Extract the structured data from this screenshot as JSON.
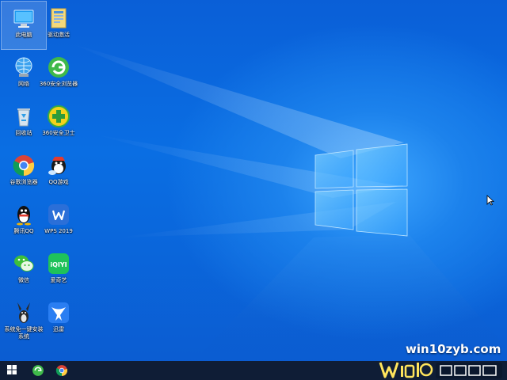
{
  "desktop": {
    "icons": [
      {
        "label": "此电脑",
        "icon": "computer-icon"
      },
      {
        "label": "驱动激活",
        "icon": "folder-icon"
      },
      {
        "label": "网络",
        "icon": "network-icon"
      },
      {
        "label": "360安全浏览器",
        "icon": "browser-360-icon"
      },
      {
        "label": "回收站",
        "icon": "recycle-bin-icon"
      },
      {
        "label": "360安全卫士",
        "icon": "security-360-icon"
      },
      {
        "label": "谷歌浏览器",
        "icon": "chrome-icon"
      },
      {
        "label": "QQ游戏",
        "icon": "qq-game-icon"
      },
      {
        "label": "腾讯QQ",
        "icon": "qq-icon"
      },
      {
        "label": "WPS 2019",
        "icon": "wps-icon"
      },
      {
        "label": "微信",
        "icon": "wechat-icon"
      },
      {
        "label": "爱奇艺",
        "icon": "iqiyi-icon"
      },
      {
        "label": "系统免一键安装系统",
        "icon": "installer-icon"
      },
      {
        "label": "迅雷",
        "icon": "thunder-icon"
      }
    ],
    "watermark": "win10zyb.com"
  },
  "taskbar": {
    "items": [
      {
        "name": "start",
        "icon": "windows-start-icon"
      },
      {
        "name": "360-browser",
        "icon": "browser-360-icon"
      },
      {
        "name": "chrome",
        "icon": "chrome-icon"
      }
    ]
  },
  "colors": {
    "wallpaper_blue": "#0a66dd",
    "taskbar": "#101828",
    "icon_label": "#ffffff"
  }
}
